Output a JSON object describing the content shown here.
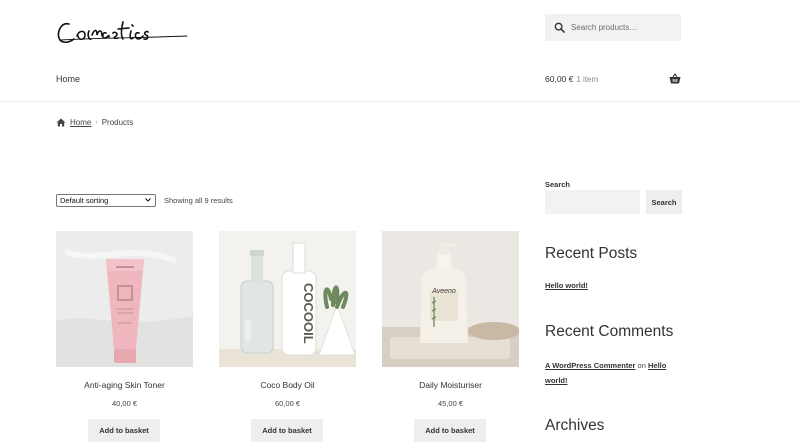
{
  "header": {
    "logo_text": "Cosmetics",
    "search_placeholder": "Search products…",
    "nav_home": "Home",
    "cart_total": "60,00 €",
    "cart_count": "1 item"
  },
  "breadcrumb": {
    "home": "Home",
    "current": "Products"
  },
  "shop": {
    "sort_selected": "Default sorting",
    "results_text": "Showing all 9 results",
    "products": [
      {
        "name": "Anti-aging Skin Toner",
        "price": "40,00 €",
        "button": "Add to basket",
        "image": "pink-toner-tube"
      },
      {
        "name": "Coco Body Oil",
        "price": "60,00 €",
        "button": "Add to basket",
        "image": "white-oil-bottle"
      },
      {
        "name": "Daily Moisturiser",
        "price": "45,00 €",
        "button": "Add to basket",
        "image": "moisturiser-pump-bottle"
      }
    ]
  },
  "sidebar": {
    "search_label": "Search",
    "search_button": "Search",
    "recent_posts_title": "Recent Posts",
    "recent_post_1": "Hello world!",
    "recent_comments_title": "Recent Comments",
    "comment_author": "A WordPress Commenter",
    "comment_on": "on",
    "comment_post": "Hello world!",
    "archives_title": "Archives"
  },
  "colors": {
    "toner_pink": "#efb6bd",
    "panel_grey": "#f2f2f2",
    "button_grey": "#eeeeee"
  }
}
